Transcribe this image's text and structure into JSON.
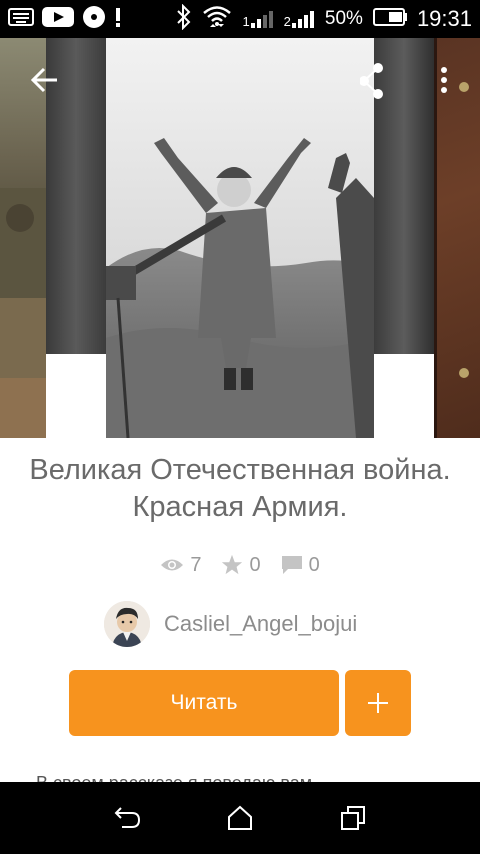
{
  "status_bar": {
    "icons": [
      "keyboard-icon",
      "youtube-icon",
      "media-icon",
      "alert-icon",
      "bluetooth-icon",
      "wifi-icon",
      "signal-sim1-icon",
      "signal-sim2-icon",
      "battery-icon"
    ],
    "sim1_label": "1",
    "sim2_label": "2",
    "battery": "50%",
    "time": "19:31"
  },
  "toolbar": {
    "back_icon": "arrow-back-icon",
    "share_icon": "share-icon",
    "menu_icon": "more-vert-icon"
  },
  "book": {
    "title": "Великая Отечественная война. Красная Армия.",
    "stats": {
      "views": "7",
      "stars": "0",
      "comments": "0"
    },
    "author": "Casliel_Angel_bojui",
    "read_label": "Читать",
    "add_label": "+",
    "description": "В своем рассказе я поведаю вам..."
  },
  "colors": {
    "accent": "#f7931e",
    "text_muted": "#9a9a9a",
    "title": "#6a6a6a"
  },
  "nav_bar": {
    "icons": [
      "back-nav-icon",
      "home-nav-icon",
      "recents-nav-icon"
    ]
  }
}
